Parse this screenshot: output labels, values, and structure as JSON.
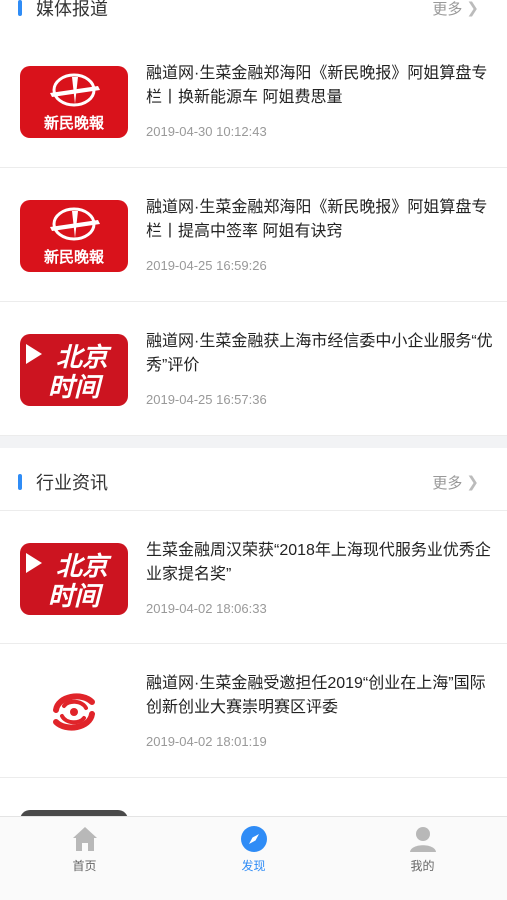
{
  "sections": [
    {
      "title": "媒体报道",
      "more": "更多"
    },
    {
      "title": "行业资讯",
      "more": "更多"
    }
  ],
  "logos": {
    "xinmin": {
      "text": "新民晚報",
      "color": "#d9121b"
    },
    "beijing": {
      "line1": "北京",
      "line2": "时间",
      "color": "#cc1420"
    },
    "fenghuang": {
      "color": "#e0242a"
    }
  },
  "media_items": [
    {
      "headline": "融道网·生菜金融郑海阳《新民晚报》阿姐算盘专栏丨换新能源车 阿姐费思量",
      "time": "2019-04-30 10:12:43",
      "logo": "xinmin-logo"
    },
    {
      "headline": "融道网·生菜金融郑海阳《新民晚报》阿姐算盘专栏丨提高中签率 阿姐有诀窍",
      "time": "2019-04-25 16:59:26",
      "logo": "xinmin-logo"
    },
    {
      "headline": "融道网·生菜金融获上海市经信委中小企业服务“优秀”评价",
      "time": "2019-04-25 16:57:36",
      "logo": "beijing-time-logo"
    }
  ],
  "industry_items": [
    {
      "headline": "生菜金融周汉荣获“2018年上海现代服务业优秀企业家提名奖”",
      "time": "2019-04-02 18:06:33",
      "logo": "beijing-time-logo"
    },
    {
      "headline": "融道网·生菜金融受邀担任2019“创业在上海”国际创新创业大赛崇明赛区评委",
      "time": "2019-04-02 18:01:19",
      "logo": "phoenix-logo"
    }
  ],
  "tabbar": {
    "tabs": [
      {
        "label": "首页",
        "icon": "home-icon",
        "active": false
      },
      {
        "label": "发现",
        "icon": "compass-icon",
        "active": true
      },
      {
        "label": "我的",
        "icon": "user-icon",
        "active": false
      }
    ],
    "active_color": "#2f8cf6",
    "inactive_color": "#b8b8b8"
  }
}
